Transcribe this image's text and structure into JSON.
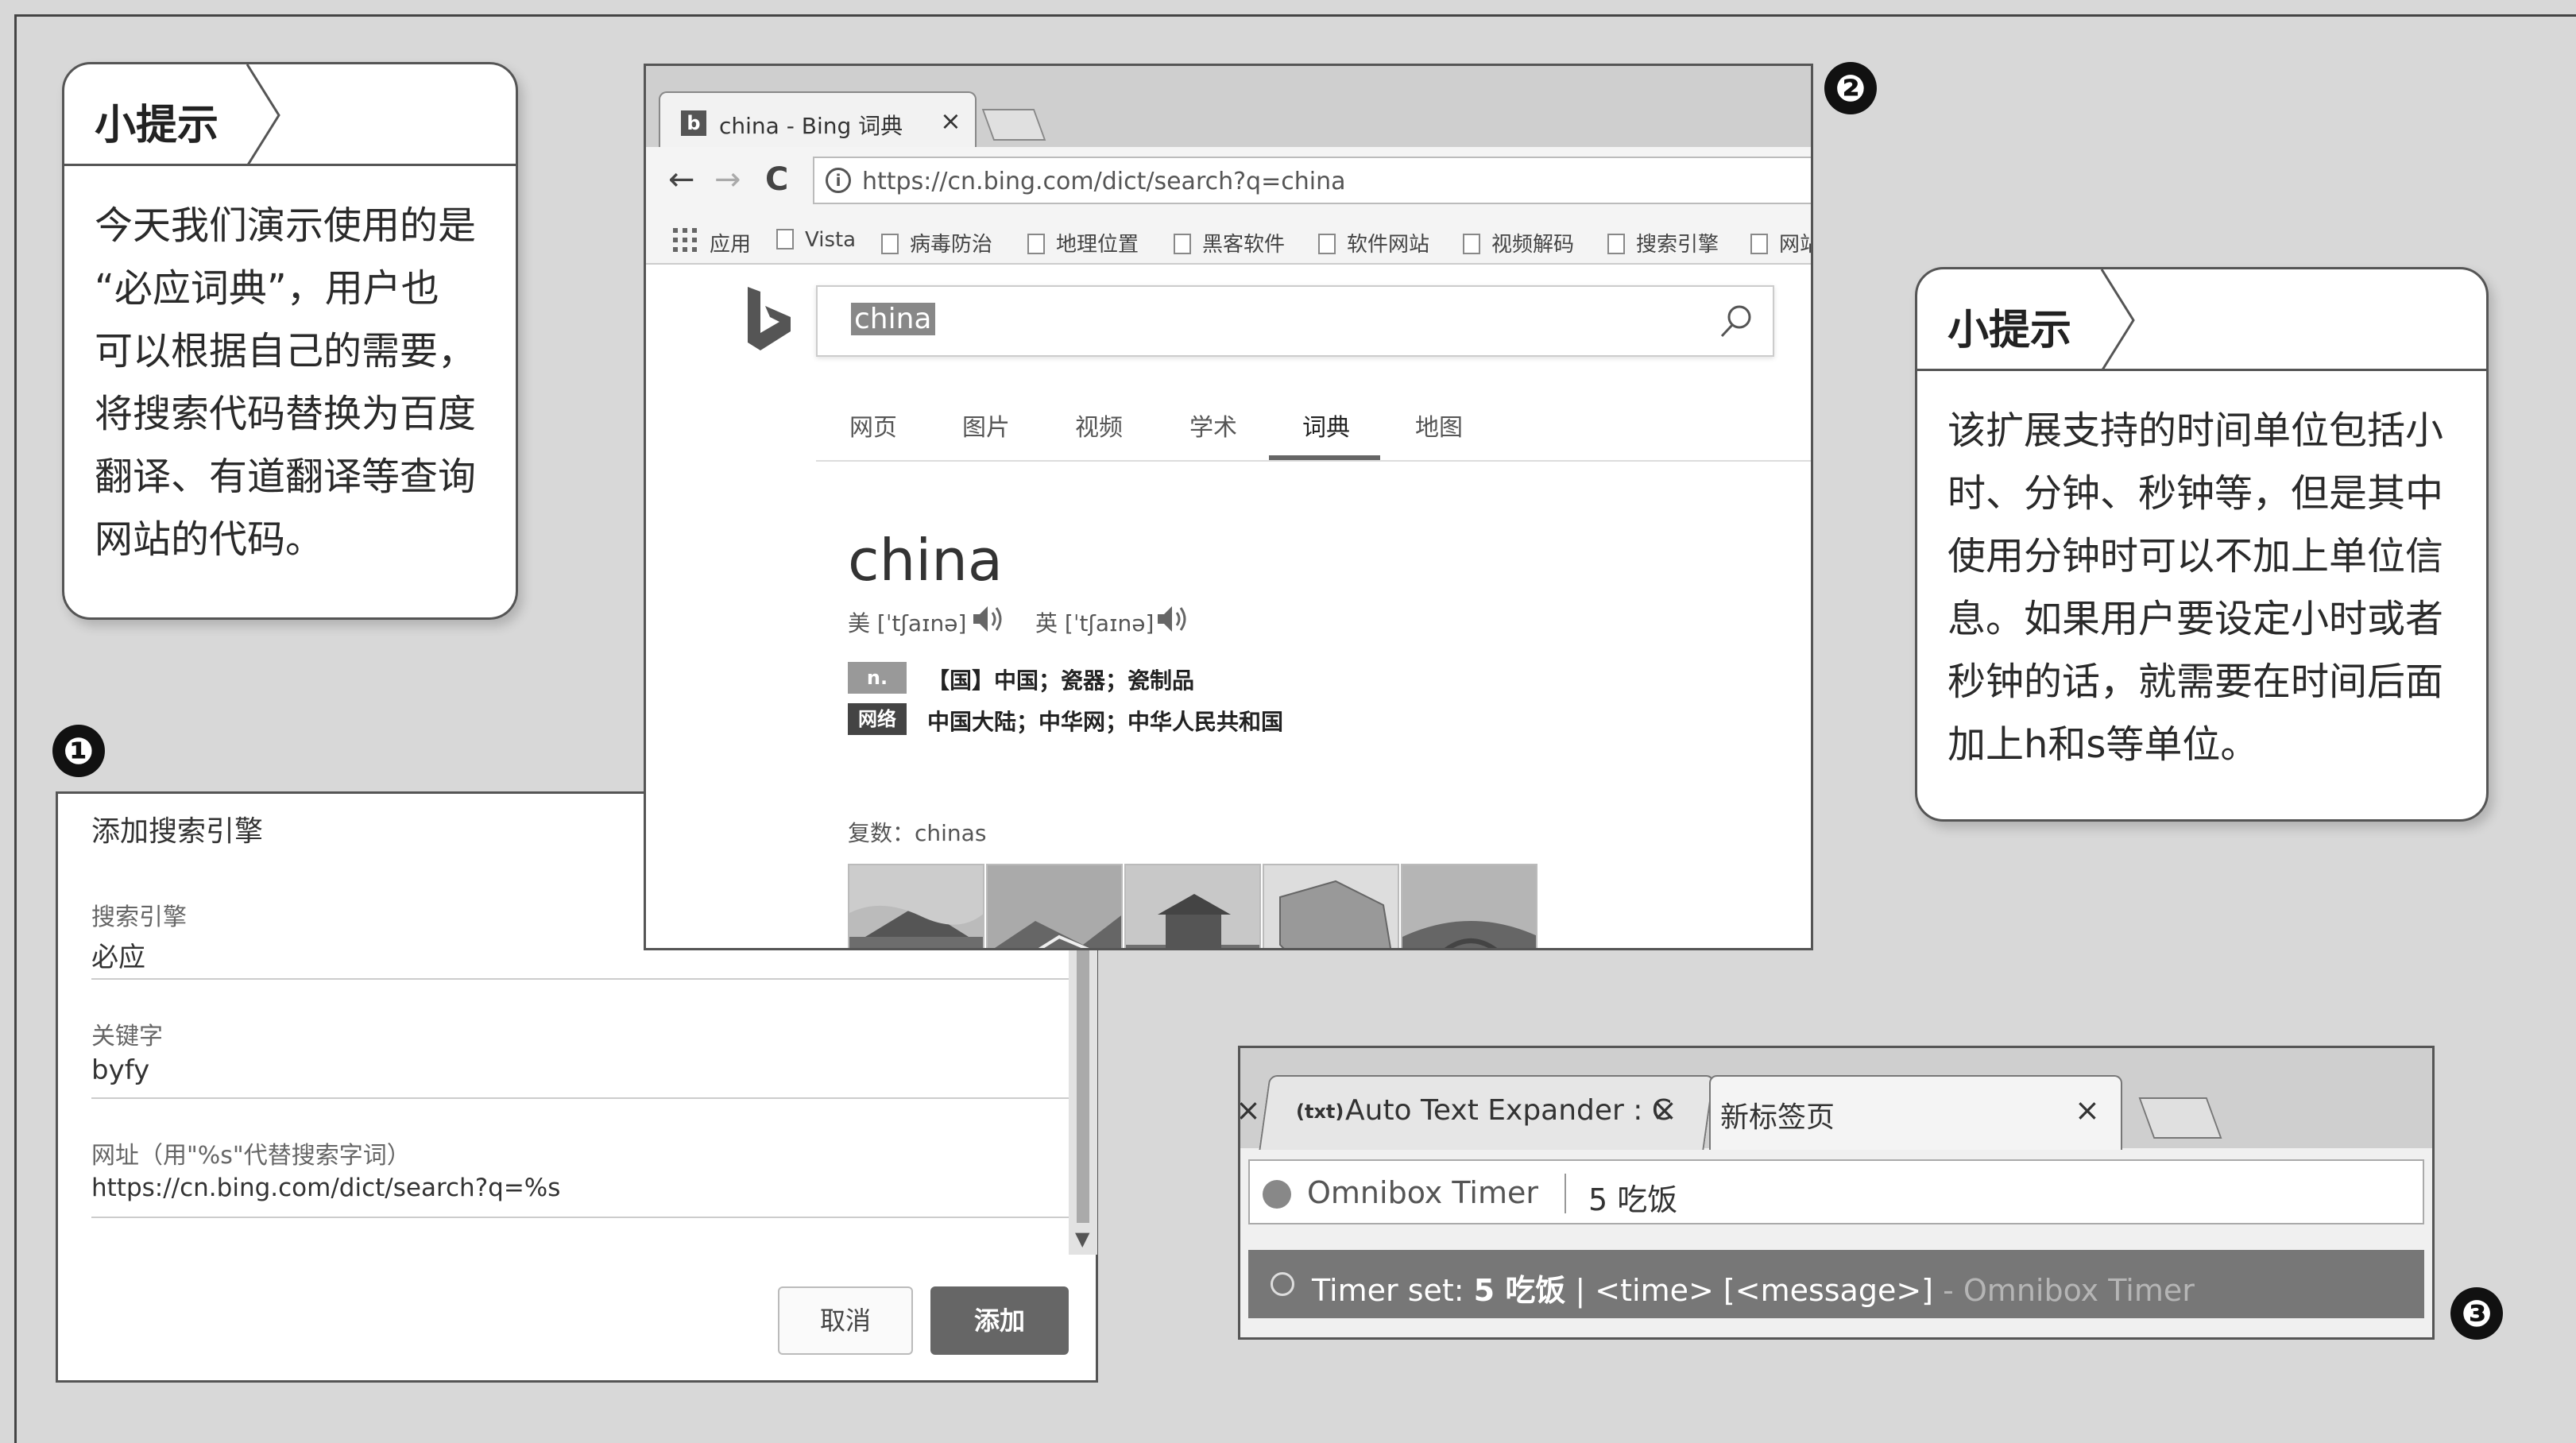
{
  "tip1": {
    "title": "小提示",
    "lines": [
      "今天我们演示使用的是",
      "“必应词典”，用户也",
      "可以根据自己的需要，",
      "将搜索代码替换为百度",
      "翻译、有道翻译等查询",
      "网站的代码。"
    ]
  },
  "tip2": {
    "title": "小提示",
    "lines": [
      "该扩展支持的时间单位包括小",
      "时、分钟、秒钟等，但是其中",
      "使用分钟时可以不加上单位信",
      "息。如果用户要设定小时或者",
      "秒钟的话，就需要在时间后面",
      "加上h和s等单位。"
    ]
  },
  "markers": {
    "one": "❶",
    "two": "❷",
    "three": "❸"
  },
  "dialog": {
    "title": "添加搜索引擎",
    "engine_label": "搜索引擎",
    "engine_value": "必应",
    "keyword_label": "关键字",
    "keyword_value": "byfy",
    "url_label": "网址（用\"%s\"代替搜索字词）",
    "url_value": "https://cn.bing.com/dict/search?q=%s",
    "cancel": "取消",
    "add": "添加"
  },
  "browser": {
    "tab_title": "china - Bing 词典",
    "tab_icon": "b",
    "tab_close": "×",
    "url": "https://cn.bing.com/dict/search?q=china",
    "bookmarks": [
      "应用",
      "Vista",
      "病毒防治",
      "地理位置",
      "黑客软件",
      "软件网站",
      "视频解码",
      "搜索引擎",
      "网站"
    ],
    "search_query": "china",
    "categories": [
      "网页",
      "图片",
      "视频",
      "学术",
      "词典",
      "地图"
    ],
    "active_category": "词典",
    "word": "china",
    "pron_us": "美 [ˈtʃaɪnə]",
    "pron_uk": "英 [ˈtʃaɪnə]",
    "defs": [
      {
        "pos": "n.",
        "text": "【国】中国；瓷器；瓷制品"
      },
      {
        "pos": "网络",
        "text": "中国大陆；中华网；中华人民共和国"
      }
    ],
    "plural": "复数：chinas",
    "icons": {
      "back": "←",
      "forward": "→",
      "reload": "C",
      "info": "i"
    }
  },
  "timer": {
    "tab1_title": "Auto Text Expander : C",
    "tab1_icon": "(txt)",
    "tab1_close": "×",
    "tab0_close": "×",
    "tab2_title": "新标签页",
    "tab2_close": "×",
    "omni_name": "Omnibox Timer",
    "omni_query": "5 吃饭",
    "suggestion_prefix": "Timer set: ",
    "suggestion_bold": "5 吃饭",
    "suggestion_rest": " | <time> [<message>]",
    "suggestion_source": " - Omnibox Timer"
  }
}
